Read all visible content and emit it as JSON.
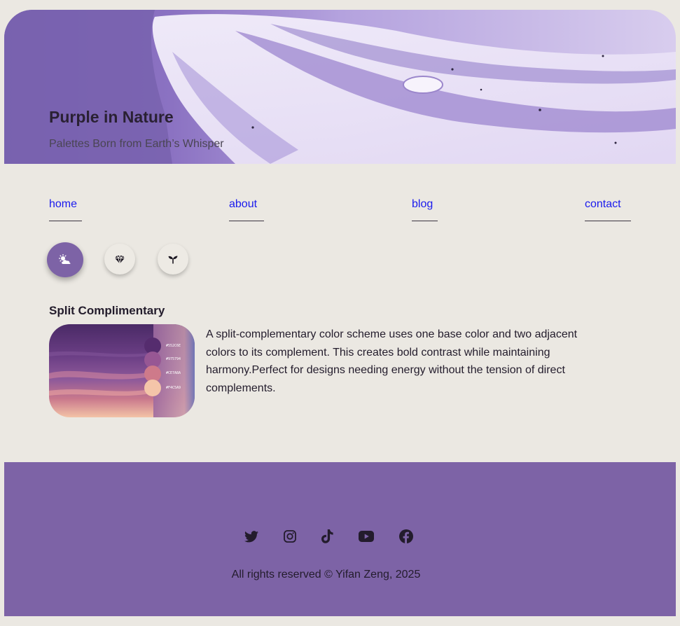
{
  "header": {
    "title": "Purple in Nature",
    "subtitle": "Palettes Born from Earth’s Whisper"
  },
  "nav": {
    "items": [
      {
        "label": "home"
      },
      {
        "label": "about"
      },
      {
        "label": "blog"
      },
      {
        "label": "contact"
      }
    ]
  },
  "category_buttons": [
    {
      "icon": "cloud-sun-icon",
      "active": true
    },
    {
      "icon": "gem-icon",
      "active": false
    },
    {
      "icon": "sprout-icon",
      "active": false
    }
  ],
  "section": {
    "title": "Split Complimentary",
    "description": "A split-complementary color scheme uses one base color and two adjacent colors to its complement. This creates bold contrast while maintaining harmony.Perfect for designs needing energy without the tension of direct complements.",
    "palette": [
      {
        "hex": "#552C6E",
        "label": "#552C6E"
      },
      {
        "hex": "#975794",
        "label": "#975794"
      },
      {
        "hex": "#CE7A8A",
        "label": "#CE7A8A"
      },
      {
        "hex": "#F4C5A9",
        "label": "#F4C5A9"
      }
    ]
  },
  "footer": {
    "social": [
      "twitter-icon",
      "instagram-icon",
      "tiktok-icon",
      "youtube-icon",
      "facebook-icon"
    ],
    "copyright": "All rights reserved © Yifan Zeng, 2025"
  },
  "colors": {
    "accent": "#7D63A6",
    "background": "#EBE8E2",
    "link": "#1A1AEE"
  }
}
